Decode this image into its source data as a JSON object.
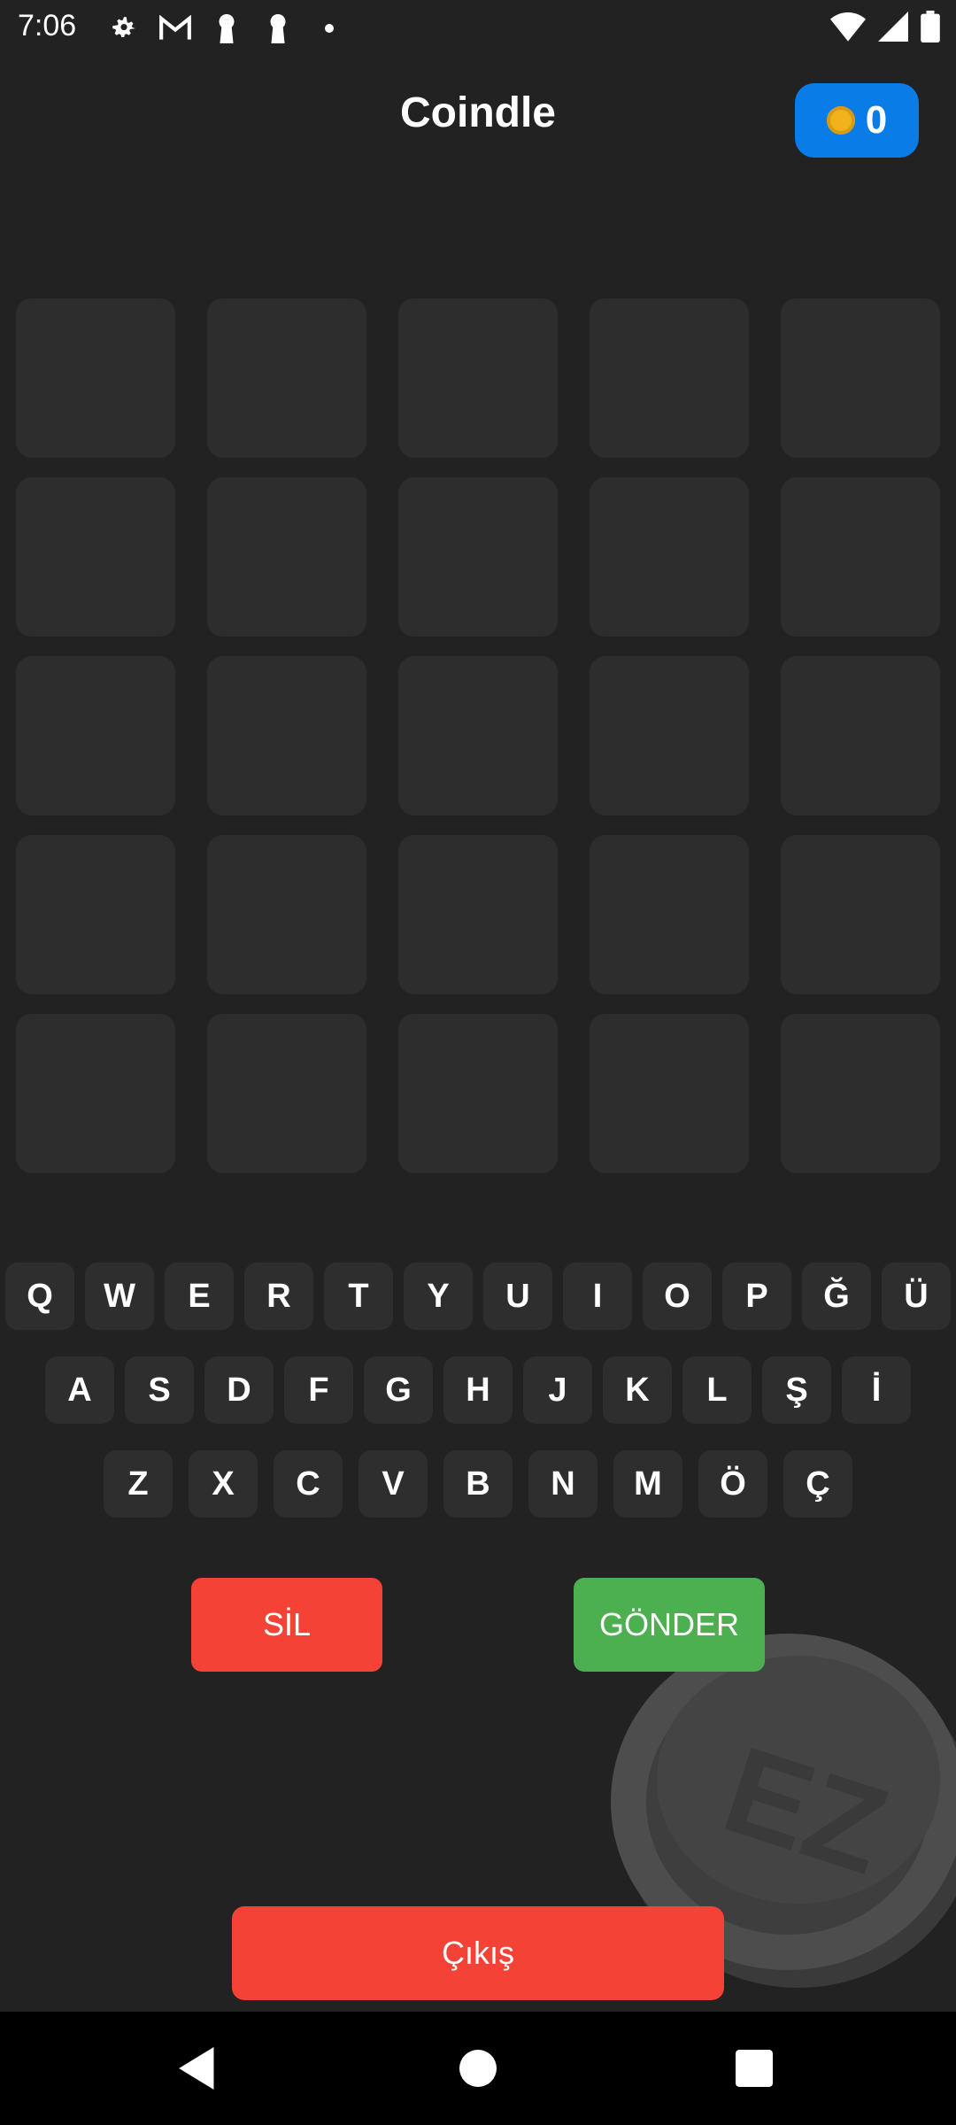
{
  "status_bar": {
    "time": "7:06",
    "left_icons": [
      "gear-icon",
      "gmail-icon",
      "keyhole-icon",
      "keyhole-icon",
      "dot-icon"
    ],
    "right_icons": [
      "wifi-icon",
      "signal-icon",
      "battery-icon"
    ]
  },
  "header": {
    "title": "Coindle",
    "coin_count": "0"
  },
  "board": {
    "rows": 5,
    "cols": 5
  },
  "keyboard": {
    "row1": [
      "Q",
      "W",
      "E",
      "R",
      "T",
      "Y",
      "U",
      "I",
      "O",
      "P",
      "Ğ",
      "Ü"
    ],
    "row2": [
      "A",
      "S",
      "D",
      "F",
      "G",
      "H",
      "J",
      "K",
      "L",
      "Ş",
      "İ"
    ],
    "row3": [
      "Z",
      "X",
      "C",
      "V",
      "B",
      "N",
      "M",
      "Ö",
      "Ç"
    ]
  },
  "actions": {
    "delete_label": "SİL",
    "submit_label": "GÖNDER",
    "exit_label": "Çıkış"
  },
  "colors": {
    "background": "#222222",
    "tile": "#2d2d2d",
    "key": "#2e2e2e",
    "coin_badge": "#0a7ce8",
    "delete": "#f44336",
    "submit": "#4caf50",
    "exit": "#f44336"
  }
}
